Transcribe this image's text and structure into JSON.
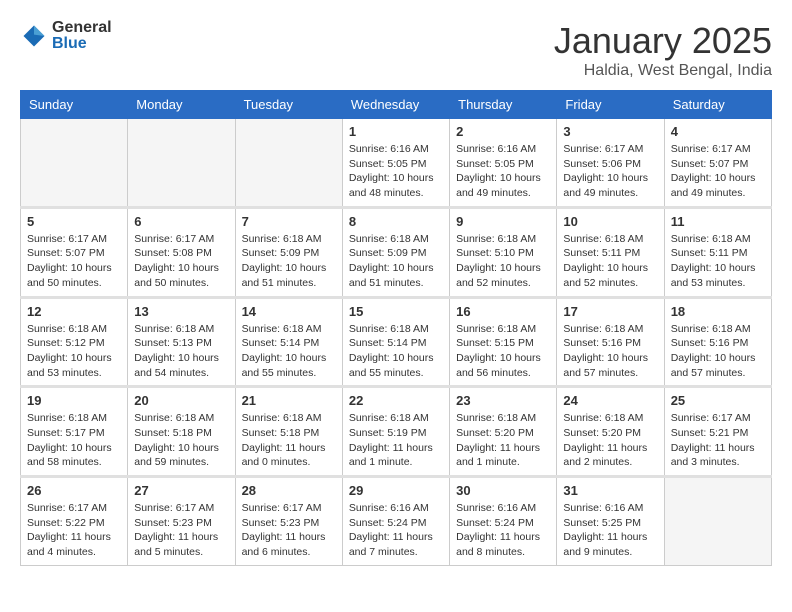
{
  "logo": {
    "general": "General",
    "blue": "Blue"
  },
  "title": "January 2025",
  "location": "Haldia, West Bengal, India",
  "days_header": [
    "Sunday",
    "Monday",
    "Tuesday",
    "Wednesday",
    "Thursday",
    "Friday",
    "Saturday"
  ],
  "weeks": [
    [
      {
        "day": "",
        "info": ""
      },
      {
        "day": "",
        "info": ""
      },
      {
        "day": "",
        "info": ""
      },
      {
        "day": "1",
        "info": "Sunrise: 6:16 AM\nSunset: 5:05 PM\nDaylight: 10 hours\nand 48 minutes."
      },
      {
        "day": "2",
        "info": "Sunrise: 6:16 AM\nSunset: 5:05 PM\nDaylight: 10 hours\nand 49 minutes."
      },
      {
        "day": "3",
        "info": "Sunrise: 6:17 AM\nSunset: 5:06 PM\nDaylight: 10 hours\nand 49 minutes."
      },
      {
        "day": "4",
        "info": "Sunrise: 6:17 AM\nSunset: 5:07 PM\nDaylight: 10 hours\nand 49 minutes."
      }
    ],
    [
      {
        "day": "5",
        "info": "Sunrise: 6:17 AM\nSunset: 5:07 PM\nDaylight: 10 hours\nand 50 minutes."
      },
      {
        "day": "6",
        "info": "Sunrise: 6:17 AM\nSunset: 5:08 PM\nDaylight: 10 hours\nand 50 minutes."
      },
      {
        "day": "7",
        "info": "Sunrise: 6:18 AM\nSunset: 5:09 PM\nDaylight: 10 hours\nand 51 minutes."
      },
      {
        "day": "8",
        "info": "Sunrise: 6:18 AM\nSunset: 5:09 PM\nDaylight: 10 hours\nand 51 minutes."
      },
      {
        "day": "9",
        "info": "Sunrise: 6:18 AM\nSunset: 5:10 PM\nDaylight: 10 hours\nand 52 minutes."
      },
      {
        "day": "10",
        "info": "Sunrise: 6:18 AM\nSunset: 5:11 PM\nDaylight: 10 hours\nand 52 minutes."
      },
      {
        "day": "11",
        "info": "Sunrise: 6:18 AM\nSunset: 5:11 PM\nDaylight: 10 hours\nand 53 minutes."
      }
    ],
    [
      {
        "day": "12",
        "info": "Sunrise: 6:18 AM\nSunset: 5:12 PM\nDaylight: 10 hours\nand 53 minutes."
      },
      {
        "day": "13",
        "info": "Sunrise: 6:18 AM\nSunset: 5:13 PM\nDaylight: 10 hours\nand 54 minutes."
      },
      {
        "day": "14",
        "info": "Sunrise: 6:18 AM\nSunset: 5:14 PM\nDaylight: 10 hours\nand 55 minutes."
      },
      {
        "day": "15",
        "info": "Sunrise: 6:18 AM\nSunset: 5:14 PM\nDaylight: 10 hours\nand 55 minutes."
      },
      {
        "day": "16",
        "info": "Sunrise: 6:18 AM\nSunset: 5:15 PM\nDaylight: 10 hours\nand 56 minutes."
      },
      {
        "day": "17",
        "info": "Sunrise: 6:18 AM\nSunset: 5:16 PM\nDaylight: 10 hours\nand 57 minutes."
      },
      {
        "day": "18",
        "info": "Sunrise: 6:18 AM\nSunset: 5:16 PM\nDaylight: 10 hours\nand 57 minutes."
      }
    ],
    [
      {
        "day": "19",
        "info": "Sunrise: 6:18 AM\nSunset: 5:17 PM\nDaylight: 10 hours\nand 58 minutes."
      },
      {
        "day": "20",
        "info": "Sunrise: 6:18 AM\nSunset: 5:18 PM\nDaylight: 10 hours\nand 59 minutes."
      },
      {
        "day": "21",
        "info": "Sunrise: 6:18 AM\nSunset: 5:18 PM\nDaylight: 11 hours\nand 0 minutes."
      },
      {
        "day": "22",
        "info": "Sunrise: 6:18 AM\nSunset: 5:19 PM\nDaylight: 11 hours\nand 1 minute."
      },
      {
        "day": "23",
        "info": "Sunrise: 6:18 AM\nSunset: 5:20 PM\nDaylight: 11 hours\nand 1 minute."
      },
      {
        "day": "24",
        "info": "Sunrise: 6:18 AM\nSunset: 5:20 PM\nDaylight: 11 hours\nand 2 minutes."
      },
      {
        "day": "25",
        "info": "Sunrise: 6:17 AM\nSunset: 5:21 PM\nDaylight: 11 hours\nand 3 minutes."
      }
    ],
    [
      {
        "day": "26",
        "info": "Sunrise: 6:17 AM\nSunset: 5:22 PM\nDaylight: 11 hours\nand 4 minutes."
      },
      {
        "day": "27",
        "info": "Sunrise: 6:17 AM\nSunset: 5:23 PM\nDaylight: 11 hours\nand 5 minutes."
      },
      {
        "day": "28",
        "info": "Sunrise: 6:17 AM\nSunset: 5:23 PM\nDaylight: 11 hours\nand 6 minutes."
      },
      {
        "day": "29",
        "info": "Sunrise: 6:16 AM\nSunset: 5:24 PM\nDaylight: 11 hours\nand 7 minutes."
      },
      {
        "day": "30",
        "info": "Sunrise: 6:16 AM\nSunset: 5:24 PM\nDaylight: 11 hours\nand 8 minutes."
      },
      {
        "day": "31",
        "info": "Sunrise: 6:16 AM\nSunset: 5:25 PM\nDaylight: 11 hours\nand 9 minutes."
      },
      {
        "day": "",
        "info": ""
      }
    ]
  ]
}
